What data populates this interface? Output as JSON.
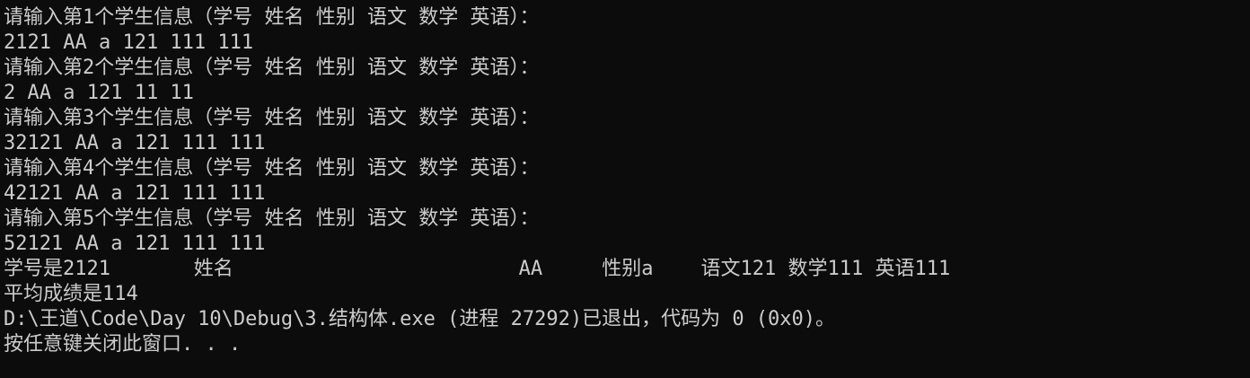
{
  "console": {
    "background": "#0c0c0c",
    "foreground": "#cccccc",
    "lines": [
      "请输入第1个学生信息（学号 姓名 性别 语文 数学 英语）：",
      "2121 AA a 121 111 111",
      "请输入第2个学生信息（学号 姓名 性别 语文 数学 英语）：",
      "2 AA a 121 11 11",
      "请输入第3个学生信息（学号 姓名 性别 语文 数学 英语）：",
      "32121 AA a 121 111 111",
      "请输入第4个学生信息（学号 姓名 性别 语文 数学 英语）：",
      "42121 AA a 121 111 111",
      "请输入第5个学生信息（学号 姓名 性别 语文 数学 英语）：",
      "52121 AA a 121 111 111",
      "学号是2121       姓名                        AA     性别a    语文121 数学111 英语111",
      "平均成绩是114",
      "D:\\王道\\Code\\Day 10\\Debug\\3.结构体.exe (进程 27292)已退出，代码为 0 (0x0)。",
      "按任意键关闭此窗口. . ."
    ]
  }
}
